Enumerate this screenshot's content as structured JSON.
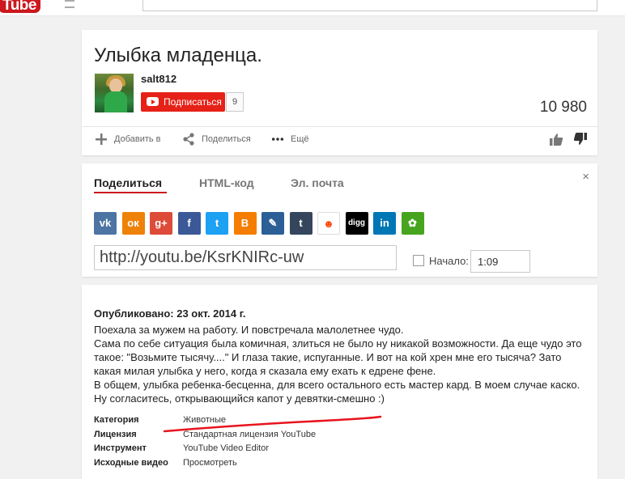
{
  "topbar": {
    "logo_text": "Tube"
  },
  "video": {
    "title": "Улыбка младенца.",
    "channel": "salt812",
    "subscribe_label": "Подписаться",
    "subscriber_count": "9",
    "view_count": "10 980"
  },
  "actions": {
    "add_label": "Добавить в",
    "share_label": "Поделиться",
    "more_label": "Ещё"
  },
  "share": {
    "tabs": [
      {
        "label": "Поделиться",
        "active": true
      },
      {
        "label": "HTML-код",
        "active": false
      },
      {
        "label": "Эл. почта",
        "active": false
      }
    ],
    "close_glyph": "×",
    "social_icons": [
      {
        "name": "vk-icon",
        "color": "#4c75a3",
        "glyph": "vk"
      },
      {
        "name": "odnoklassniki-icon",
        "color": "#ee8208",
        "glyph": "ок"
      },
      {
        "name": "google-plus-icon",
        "color": "#dd4b39",
        "glyph": "g+"
      },
      {
        "name": "facebook-icon",
        "color": "#3b5998",
        "glyph": "f"
      },
      {
        "name": "twitter-icon",
        "color": "#1da1f2",
        "glyph": "t"
      },
      {
        "name": "blogger-icon",
        "color": "#f57d00",
        "glyph": "B"
      },
      {
        "name": "livejournal-icon",
        "color": "#2c5f96",
        "glyph": "✎"
      },
      {
        "name": "tumblr-icon",
        "color": "#35465c",
        "glyph": "t"
      },
      {
        "name": "reddit-icon",
        "color": "#ffffff",
        "glyph": "☻"
      },
      {
        "name": "digg-icon",
        "color": "#000000",
        "glyph": "digg"
      },
      {
        "name": "linkedin-icon",
        "color": "#0077b5",
        "glyph": "in"
      },
      {
        "name": "stumbleupon-icon",
        "color": "#47a41f",
        "glyph": "✿"
      }
    ],
    "url": "http://youtu.be/KsrKNIRc-uw",
    "start_label": "Начало:",
    "start_time": "1:09"
  },
  "description": {
    "published": "Опубликовано: 23 окт. 2014 г.",
    "lines": [
      "Поехала за мужем на работу. И повстречала малолетнее чудо.",
      "Сама по себе ситуация была комичная, злиться не было ну никакой возможности. Да еще чудо это",
      "такое: \"Возьмите тысячу....\" И глаза такие, испуганные. И вот на кой хрен мне его тысяча? Зато",
      "какая милая улыбка у него, когда я сказала ему ехать к едрене фене.",
      "В общем, улыбка ребенка-бесценна, для всего остального есть мастер кард. В моем случае каско.",
      "Ну согласитесь, открывающийся капот у девятки-смешно :)"
    ],
    "meta": [
      {
        "label": "Категория",
        "value": "Животные"
      },
      {
        "label": "Лицензия",
        "value": "Стандартная лицензия YouTube"
      },
      {
        "label": "Инструмент",
        "value": "YouTube Video Editor"
      },
      {
        "label": "Исходные видео",
        "value": "Просмотреть"
      }
    ]
  },
  "colors": {
    "brand_red": "#cc181e",
    "subscribe_red": "#e62117",
    "annotation_red": "#e8141e"
  }
}
